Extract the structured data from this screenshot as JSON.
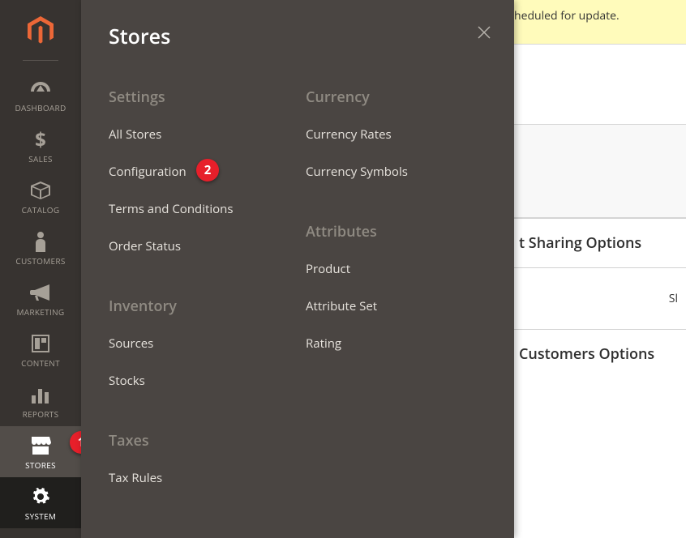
{
  "sidebar": {
    "items": [
      {
        "label": "DASHBOARD"
      },
      {
        "label": "SALES"
      },
      {
        "label": "CATALOG"
      },
      {
        "label": "CUSTOMERS"
      },
      {
        "label": "MARKETING"
      },
      {
        "label": "CONTENT"
      },
      {
        "label": "REPORTS"
      },
      {
        "label": "STORES"
      },
      {
        "label": "SYSTEM"
      }
    ]
  },
  "flyout": {
    "title": "Stores",
    "columns": [
      {
        "sections": [
          {
            "heading": "Settings",
            "links": [
              "All Stores",
              "Configuration",
              "Terms and Conditions",
              "Order Status"
            ]
          },
          {
            "heading": "Inventory",
            "links": [
              "Sources",
              "Stocks"
            ]
          },
          {
            "heading": "Taxes",
            "links": [
              "Tax Rules"
            ]
          }
        ]
      },
      {
        "sections": [
          {
            "heading": "Currency",
            "links": [
              "Currency Rates",
              "Currency Symbols"
            ]
          },
          {
            "heading": "Attributes",
            "links": [
              "Product",
              "Attribute Set",
              "Rating"
            ]
          }
        ]
      }
    ]
  },
  "background": {
    "banner": "heduled for update.",
    "section1": "t Sharing Options",
    "section2_right": "Sl",
    "section3": "Customers Options"
  },
  "annotations": {
    "badge1": "1",
    "badge2": "2"
  }
}
